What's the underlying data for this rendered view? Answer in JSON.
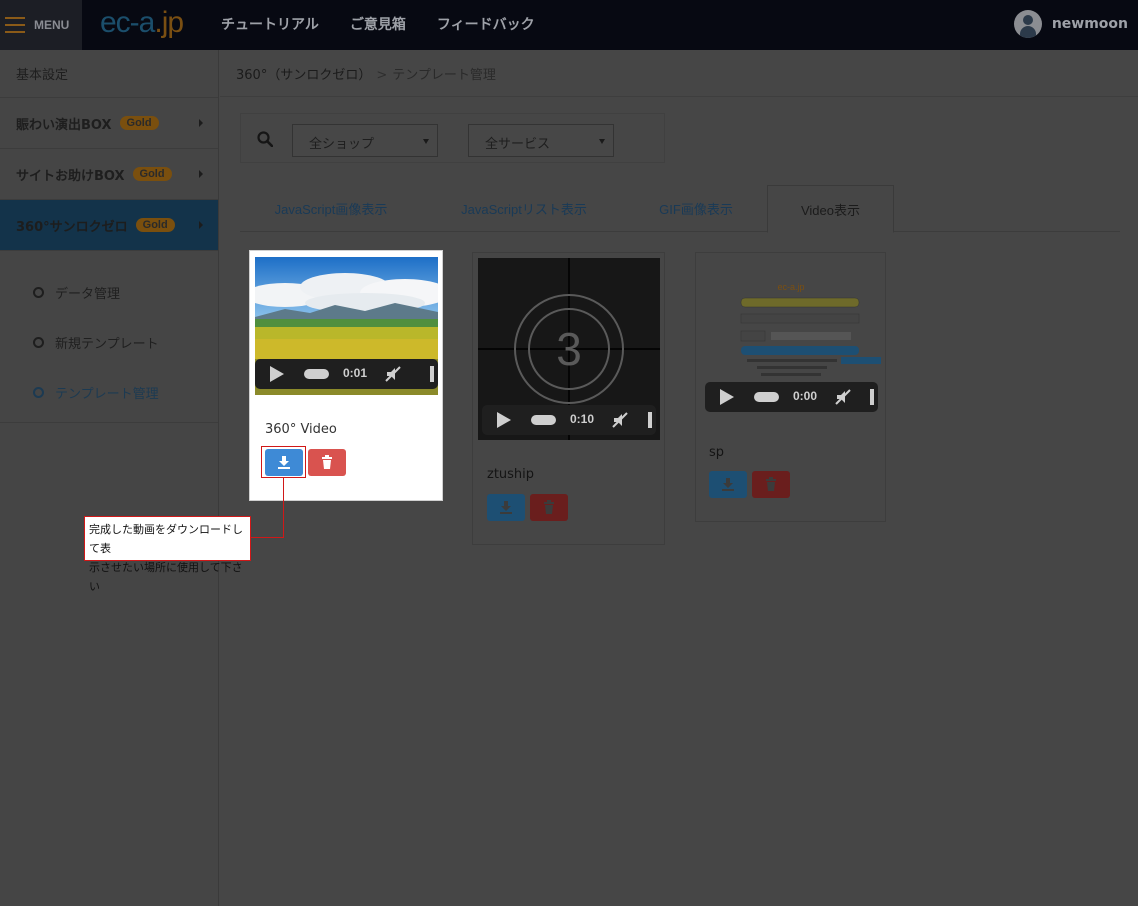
{
  "header": {
    "menu_label": "MENU",
    "logo_part1": "ec-a",
    "logo_part2": ".jp",
    "nav": [
      "チュートリアル",
      "ご意見箱",
      "フィードバック"
    ],
    "username": "newmoon"
  },
  "sidebar": {
    "items": [
      {
        "label": "基本設定"
      },
      {
        "label": "賑わい演出BOX",
        "badge": "Gold"
      },
      {
        "label": "サイトお助けBOX",
        "badge": "Gold"
      },
      {
        "label": "360°サンロクゼロ",
        "badge": "Gold"
      }
    ],
    "submenu": [
      "データ管理",
      "新規テンプレート",
      "テンプレート管理"
    ]
  },
  "breadcrumb": {
    "parent": "360°（サンロクゼロ）",
    "separator": ">",
    "current": "テンプレート管理"
  },
  "filters": {
    "shop_select": "全ショップ",
    "service_select": "全サービス"
  },
  "tabs": [
    "JavaScript画像表示",
    "JavaScriptリスト表示",
    "GIF画像表示",
    "Video表示"
  ],
  "active_tab": "Video表示",
  "videos": [
    {
      "title": "360° Video",
      "time": "0:01"
    },
    {
      "title": "ztuship",
      "time": "0:10",
      "thumb_number": "3"
    },
    {
      "title": "sp",
      "time": "0:00",
      "thumb_logo": "ec-a.jp"
    }
  ],
  "callout": {
    "line1": "完成した動画をダウンロードして表",
    "line2": "示させたい場所に使用して下さい"
  },
  "colors": {
    "download_button": "#3e8ad6",
    "delete_button": "#d9534f",
    "annotation": "#d01818",
    "badge_gold": "#7a4f0e"
  }
}
